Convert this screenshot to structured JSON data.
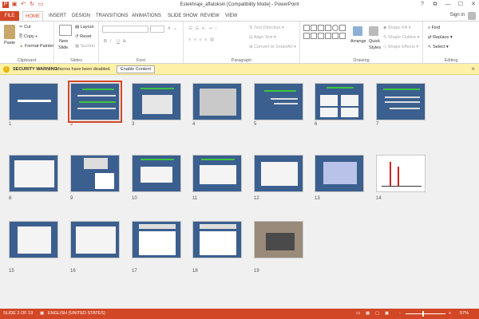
{
  "window": {
    "title": "Estekhraje_aflatoksin [Compatibility Mode] - PowerPoint",
    "controls": [
      "?",
      "⧉",
      "—",
      "☐",
      "✕"
    ],
    "qat_icons": [
      "powerpoint-logo-icon",
      "save-icon",
      "undo-icon",
      "redo-icon",
      "start-slideshow-icon"
    ]
  },
  "tabs": [
    "FILE",
    "HOME",
    "INSERT",
    "DESIGN",
    "TRANSITIONS",
    "ANIMATIONS",
    "SLIDE SHOW",
    "REVIEW",
    "VIEW"
  ],
  "active_tab": "HOME",
  "signin": "Sign in",
  "ribbon": {
    "clipboard": {
      "label": "Clipboard",
      "paste": "Paste",
      "cut": "Cut",
      "copy": "Copy",
      "format_painter": "Format Painter"
    },
    "slides": {
      "label": "Slides",
      "new_slide": "New",
      "new_slide2": "Slide",
      "layout": "Layout",
      "reset": "Reset",
      "section": "Section"
    },
    "font": {
      "label": "Font",
      "bold": "B",
      "italic": "I",
      "underline": "U",
      "strike": "S",
      "grow": "A",
      "shrink": "A"
    },
    "paragraph": {
      "label": "Paragraph",
      "text_direction": "Text Direction",
      "align_text": "Align Text",
      "convert_smartart": "Convert to SmartArt"
    },
    "drawing": {
      "label": "Drawing",
      "arrange": "Arrange",
      "quick_styles": "Quick",
      "quick_styles2": "Styles",
      "shape_fill": "Shape Fill",
      "shape_outline": "Shape Outline",
      "shape_effects": "Shape Effects"
    },
    "editing": {
      "label": "Editing",
      "find": "Find",
      "replace": "Replace",
      "select": "Select"
    }
  },
  "security": {
    "title": "SECURITY WARNING",
    "message": "Macros have been disabled.",
    "button": "Enable Content"
  },
  "slides": [
    {
      "n": "1"
    },
    {
      "n": "2"
    },
    {
      "n": "3"
    },
    {
      "n": "4"
    },
    {
      "n": "5"
    },
    {
      "n": "6"
    },
    {
      "n": "7"
    },
    {
      "n": "8"
    },
    {
      "n": "9"
    },
    {
      "n": "10"
    },
    {
      "n": "11"
    },
    {
      "n": "12"
    },
    {
      "n": "13"
    },
    {
      "n": "14"
    },
    {
      "n": "15"
    },
    {
      "n": "16"
    },
    {
      "n": "17"
    },
    {
      "n": "18"
    },
    {
      "n": "19"
    }
  ],
  "selected_slide": 2,
  "status": {
    "slide": "SLIDE 2 OF 19",
    "language": "ENGLISH (UNITED STATES)",
    "zoom": "57%",
    "minus": "-",
    "plus": "+"
  }
}
